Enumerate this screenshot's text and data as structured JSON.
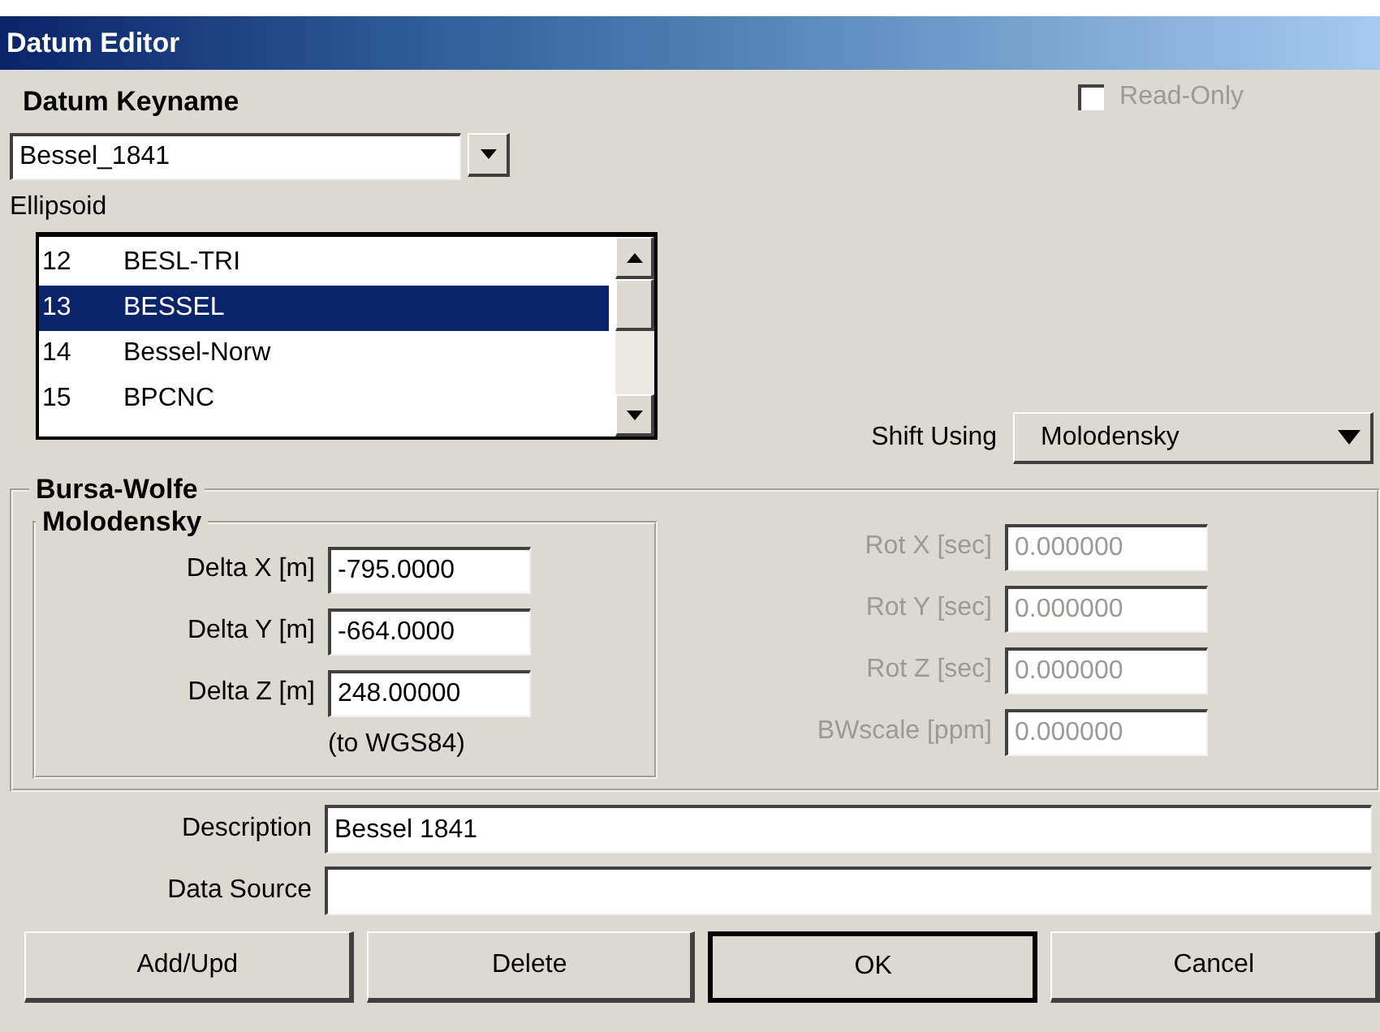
{
  "window": {
    "title": "Datum Editor"
  },
  "datum_keyname": {
    "label": "Datum Keyname",
    "value": "Bessel_1841"
  },
  "read_only": {
    "label": "Read-Only",
    "checked": false,
    "disabled": true
  },
  "ellipsoid": {
    "label": "Ellipsoid",
    "items": [
      {
        "number": "12",
        "name": "BESL-TRI",
        "selected": false
      },
      {
        "number": "13",
        "name": "BESSEL",
        "selected": true
      },
      {
        "number": "14",
        "name": "Bessel-Norw",
        "selected": false
      },
      {
        "number": "15",
        "name": "BPCNC",
        "selected": false
      }
    ]
  },
  "shift_using": {
    "label": "Shift Using",
    "value": "Molodensky"
  },
  "bursa_wolfe": {
    "title": "Bursa-Wolfe",
    "molodensky": {
      "title": "Molodensky",
      "fields": [
        {
          "label": "Delta X [m]",
          "value": "-795.0000"
        },
        {
          "label": "Delta Y [m]",
          "value": "-664.0000"
        },
        {
          "label": "Delta Z [m]",
          "value": "248.00000"
        }
      ],
      "note": "(to WGS84)"
    },
    "rotation_fields": [
      {
        "label": "Rot X [sec]",
        "value": "0.000000",
        "disabled": true
      },
      {
        "label": "Rot Y [sec]",
        "value": "0.000000",
        "disabled": true
      },
      {
        "label": "Rot Z [sec]",
        "value": "0.000000",
        "disabled": true
      },
      {
        "label": "BWscale [ppm]",
        "value": "0.000000",
        "disabled": true
      }
    ]
  },
  "description": {
    "label": "Description",
    "value": "Bessel 1841"
  },
  "data_source": {
    "label": "Data Source"
  },
  "buttons": [
    {
      "label": "Add/Upd",
      "default": false
    },
    {
      "label": "Delete",
      "default": false
    },
    {
      "label": "OK",
      "default": true
    },
    {
      "label": "Cancel",
      "default": false
    }
  ]
}
